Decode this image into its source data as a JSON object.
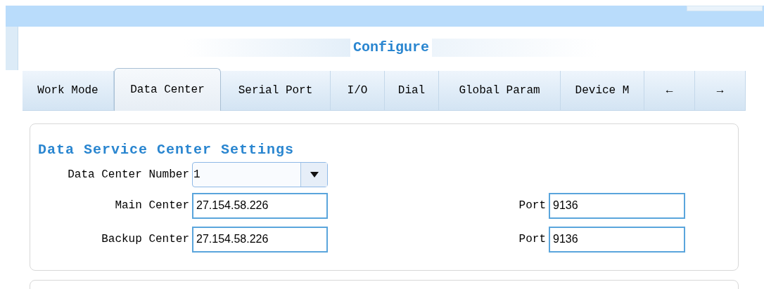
{
  "page": {
    "title": "Configure"
  },
  "tabs": [
    {
      "label": "Work Mode",
      "selected": false
    },
    {
      "label": "Data Center",
      "selected": true
    },
    {
      "label": "Serial Port",
      "selected": false
    },
    {
      "label": "I/O",
      "selected": false
    },
    {
      "label": "Dial",
      "selected": false
    },
    {
      "label": "Global Param",
      "selected": false
    },
    {
      "label": "Device M",
      "selected": false
    },
    {
      "label": "←",
      "selected": false
    },
    {
      "label": "→",
      "selected": false
    }
  ],
  "section": {
    "title": "Data Service Center Settings",
    "data_center_number": {
      "label": "Data Center Number",
      "value": "1"
    },
    "rows": [
      {
        "label": "Main Center",
        "value": "27.154.58.226",
        "port_label": "Port",
        "port": "9136"
      },
      {
        "label": "Backup Center",
        "value": "27.154.58.226",
        "port_label": "Port",
        "port": "9136"
      }
    ]
  }
}
